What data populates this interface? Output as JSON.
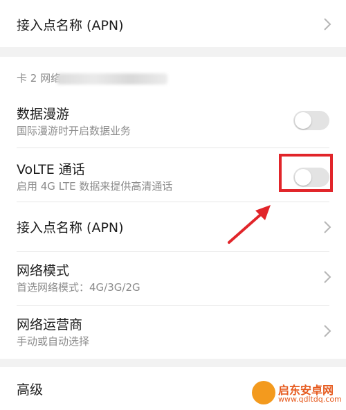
{
  "top_row": {
    "title": "接入点名称 (APN)"
  },
  "section": {
    "label": "卡 2 网络"
  },
  "rows": {
    "data_roaming": {
      "title": "数据漫游",
      "subtitle": "国际漫游时开启数据业务",
      "enabled": false
    },
    "volte": {
      "title": "VoLTE 通话",
      "subtitle": "启用 4G LTE 数据来提供高清通话",
      "enabled": false
    },
    "apn": {
      "title": "接入点名称 (APN)"
    },
    "network_mode": {
      "title": "网络模式",
      "subtitle": "首选网络模式：4G/3G/2G"
    },
    "carrier": {
      "title": "网络运营商",
      "subtitle": "手动或自动选择"
    }
  },
  "advanced": {
    "title": "高级"
  },
  "annotation": {
    "color": "#e1252a"
  },
  "watermark": {
    "title": "启东安卓网",
    "url": "www.qdltdq.com"
  },
  "icons": {
    "chevron": "chevron-right-icon",
    "arrow": "annotation-arrow-icon"
  }
}
